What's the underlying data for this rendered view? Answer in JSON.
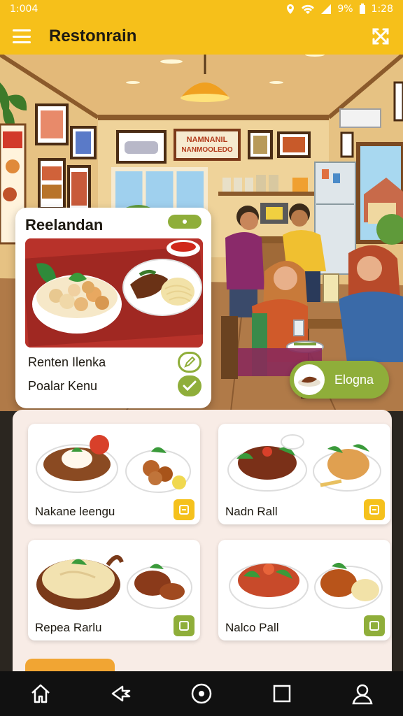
{
  "status_bar": {
    "time_left": "1:004",
    "battery": "9%",
    "time_right": "1:28"
  },
  "app_bar": {
    "title": "Restonrain"
  },
  "scene": {
    "wall_sign": "NAMNANIL\nNANMOOLEDO",
    "wall_sign_line1": "NAMNANIL",
    "wall_sign_line2": "NANMOOLEDO"
  },
  "featured": {
    "title": "Reelandan",
    "rows": [
      {
        "label": "Renten Ilenka"
      },
      {
        "label": "Poalar Kenu"
      }
    ]
  },
  "order_button": {
    "label": "Elogna"
  },
  "menu_cards": [
    {
      "label": "Nakane leengu",
      "accent": "#f5c11c"
    },
    {
      "label": "Nadn Rall",
      "accent": "#f5c11c"
    },
    {
      "label": "Repea Rarlu",
      "accent": "#8fae3a"
    },
    {
      "label": "Nalco Pall",
      "accent": "#8fae3a"
    }
  ],
  "colors": {
    "primary": "#f6c01a",
    "accent_green": "#8fae3a",
    "panel": "#f8ece6"
  },
  "nav_icons": [
    "home-icon",
    "back-icon",
    "circle-home-icon",
    "square-recents-icon",
    "profile-icon"
  ]
}
